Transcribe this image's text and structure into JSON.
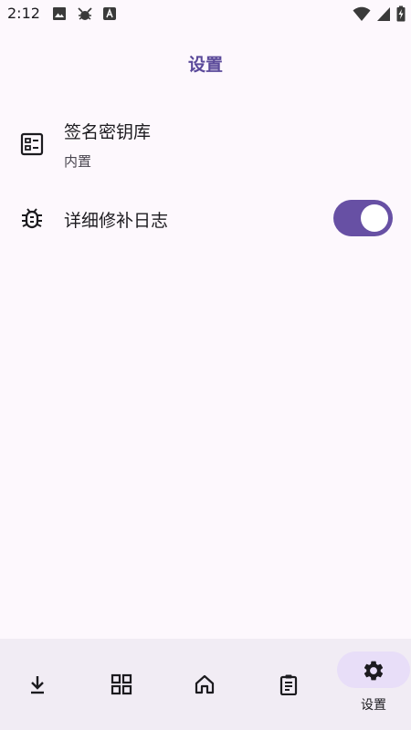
{
  "status_bar": {
    "time": "2:12",
    "icons": [
      "image-icon",
      "bug-notify-icon",
      "app-a-icon",
      "wifi-icon",
      "signal-icon",
      "battery-charging-icon"
    ]
  },
  "header": {
    "title": "设置"
  },
  "settings": {
    "keystore": {
      "title": "签名密钥库",
      "subtitle": "内置",
      "icon": "keystore-icon"
    },
    "verbose_log": {
      "title": "详细修补日志",
      "icon": "bug-icon",
      "enabled": true
    }
  },
  "bottom_nav": {
    "items": [
      {
        "icon": "download-icon"
      },
      {
        "icon": "apps-grid-icon"
      },
      {
        "icon": "home-icon"
      },
      {
        "icon": "clipboard-icon"
      },
      {
        "icon": "gear-icon",
        "label": "设置",
        "selected": true
      }
    ]
  },
  "colors": {
    "background": "#fdf8fd",
    "accent": "#6750a4",
    "title": "#5b4a9a",
    "nav_background": "#f1ecf4",
    "nav_selected_pill": "#e8def8"
  }
}
